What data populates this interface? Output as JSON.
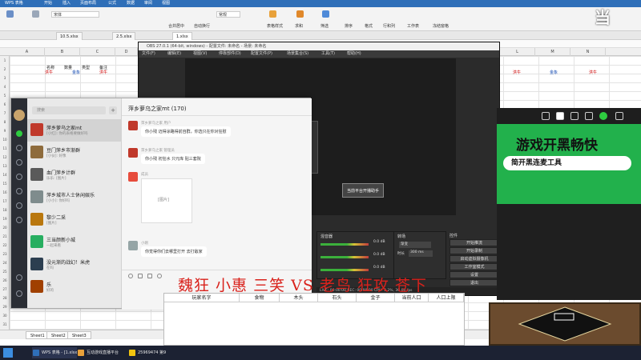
{
  "wps": {
    "title": "WPS 表格",
    "tabs_ribbon": [
      "开始",
      "插入",
      "页面布局",
      "公式",
      "数据",
      "审阅",
      "视图"
    ],
    "font_name": "宋体",
    "ribbon_labels": [
      "合并居中",
      "自动换行",
      "常规",
      "表格样式",
      "求和",
      "筛选",
      "排序",
      "格式",
      "行和列",
      "工作表",
      "冻结窗格"
    ],
    "doc_tabs": [
      "10.5.xlsx",
      "2.5.xlsx",
      "1.xlsx"
    ],
    "columns": [
      "A",
      "B",
      "C",
      "D",
      "E",
      "F",
      "G",
      "H",
      "I",
      "J",
      "K",
      "L",
      "M",
      "N"
    ],
    "cells": {
      "top_row": [
        "金钱",
        "木头",
        "食物",
        "石头",
        "兵力"
      ],
      "header_row": [
        "名称",
        "数量",
        "类型",
        "备注"
      ],
      "player_a": "洪牛",
      "player_b": "金象",
      "player_c": "洪牛",
      "right_a": "洪牛",
      "right_b": "金象",
      "right_c": "洪牛"
    },
    "sheets": [
      "Sheet1",
      "Sheet2",
      "Sheet3"
    ]
  },
  "obs": {
    "title": "OBS 27.0.1 (64-bit, windows) - 配置文件: 未命名 - 场景: 未命名",
    "menu": [
      "文件(F)",
      "编辑(E)",
      "视图(V)",
      "停靠部件(D)",
      "配置文件(P)",
      "场景集合(S)",
      "工具(T)",
      "帮助(H)"
    ],
    "mixer_title": "混音器",
    "mixer_levels": [
      "0.0 dB",
      "0.0 dB",
      "0.0 dB"
    ],
    "transition_title": "转场",
    "transition_value": "渐变",
    "duration_label": "时长",
    "duration_value": "300 ms",
    "controls_title": "控件",
    "buttons": [
      "开始推流",
      "开始录制",
      "启动虚拟摄像机",
      "工作室模式",
      "设置",
      "退出"
    ],
    "status": "LIVE: 00:00:00  REC: 00:00:00  CPU: 3.2%, 30.00 fps",
    "context_menu": "当前平台开播助手"
  },
  "chat": {
    "search_placeholder": "搜索",
    "conversations": [
      {
        "name": "萍乡萝乌之家mt",
        "preview": "[小红]: 你的表格要做好吗",
        "color": "#c0392b"
      },
      {
        "name": "豆门萍乡市渐群",
        "preview": "[小伙]: 好像",
        "color": "#8e6b3c"
      },
      {
        "name": "血门萍乡计群",
        "preview": "乐乐: [图片]",
        "color": "#5a5a5a"
      },
      {
        "name": "萍乡城市人士休闲娱乐",
        "preview": "[小小]: 你好吗",
        "color": "#7f8c8d"
      },
      {
        "name": "黎少二采",
        "preview": "[图片]",
        "color": "#b9770e"
      },
      {
        "name": "三当颜新小城",
        "preview": "一起来看",
        "color": "#27ae60"
      },
      {
        "name": "没元渐的战幻！米虎",
        "preview": "在吗",
        "color": "#2c3e50"
      },
      {
        "name": "乐",
        "preview": "好的",
        "color": "#a04000"
      },
      {
        "name": "大鹅",
        "preview": "[文件]",
        "color": "#6c3483"
      }
    ],
    "group_title": "萍乡萝乌之家mt (170)",
    "messages": [
      {
        "sender": "萍乡萝乌之家 用户",
        "text": "你小残  迈得涂路得前自群，你选只在你对狂慰"
      },
      {
        "sender": "萍乡萝乌之家 管理员",
        "text": "你小残 初狂水  只元库 贴三套院"
      },
      {
        "sender": "成员",
        "text": "[图片]"
      },
      {
        "sender": "小刚",
        "text": "你觉得你们去哪里打开  去打敌家"
      }
    ]
  },
  "game": {
    "banner_big": "游戏开黑畅快",
    "banner_sub": "简开黑连麦工具"
  },
  "overlay_title": "魏狂 小惠 三笑 VS 老鸟 狂攻 苍下",
  "table": {
    "headers": [
      "玩家名字",
      "食物",
      "木头",
      "石头",
      "金子",
      "当前人口",
      "人口上限"
    ]
  },
  "taskbar": {
    "items": [
      "WPS 表格 - [1.xlsx]",
      "互动游戏直播平台",
      "25969474 第9"
    ]
  },
  "logo_text": "当"
}
